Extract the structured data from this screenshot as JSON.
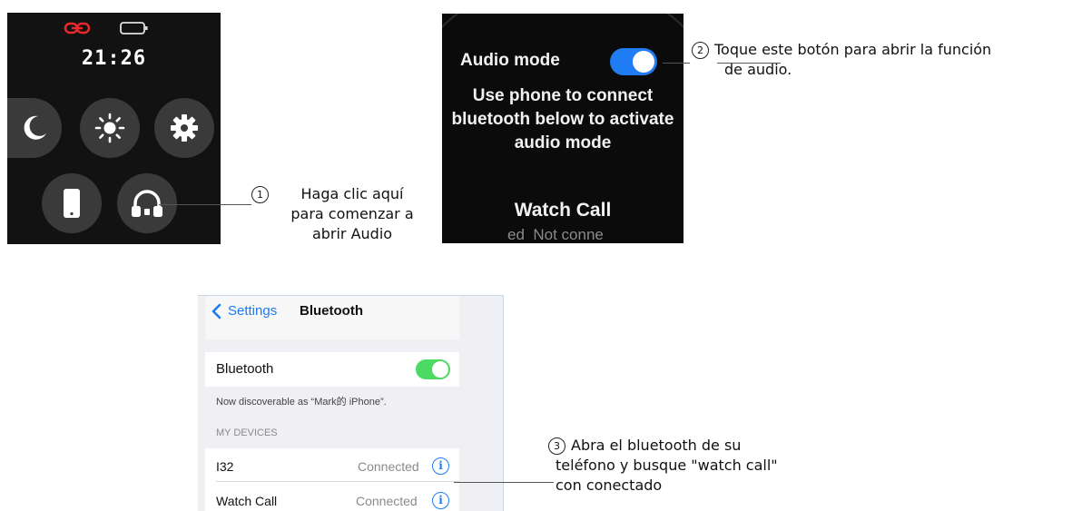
{
  "watch_menu": {
    "time": "21:26",
    "status_icons": [
      "link-icon",
      "battery-icon"
    ],
    "buttons": [
      "moon-icon",
      "brightness-icon",
      "gear-icon",
      "phone-icon",
      "headphones-icon"
    ],
    "accent": "#e8282b"
  },
  "watch_audio": {
    "mode_label": "Audio mode",
    "toggle_state": "on",
    "toggle_color": "#1f7cf2",
    "instruction_line1": "Use phone to connect",
    "instruction_line2": "bluetooth below to activate",
    "instruction_line3": "audio mode",
    "call_title": "Watch Call",
    "call_status": "ed  Not conne"
  },
  "phone": {
    "back_label": "Settings",
    "page_title": "Bluetooth",
    "bt_label": "Bluetooth",
    "bt_toggle": "on",
    "discoverable": "Now discoverable as “Mark的 iPhone”.",
    "section_header": "MY DEVICES",
    "devices": [
      {
        "name": "I32",
        "status": "Connected"
      },
      {
        "name": "Watch Call",
        "status": "Connected"
      }
    ]
  },
  "annotations": {
    "step1_num": "1",
    "step1_l1": "Haga clic aquí",
    "step1_l2": "para comenzar a",
    "step1_l3": "abrir Audio",
    "step2_num": "2",
    "step2_l1": "Toque este botón para abrir la función",
    "step2_l2": "de audio.",
    "step3_num": "3",
    "step3_l1": "Abra el bluetooth de su",
    "step3_l2": "teléfono y busque \"watch call\"",
    "step3_l3": "con conectado"
  }
}
